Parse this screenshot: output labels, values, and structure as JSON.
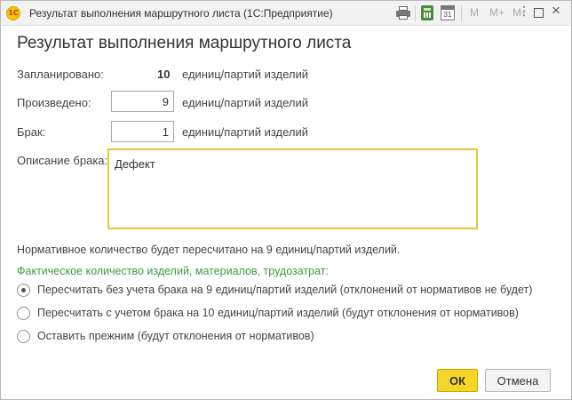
{
  "window": {
    "title": "Результат выполнения маршрутного листа  (1С:Предприятие)",
    "logo_text": "1С",
    "toolbar": {
      "m": "M",
      "m_plus": "M+",
      "m_minus": "M-",
      "calendar_day": "31"
    }
  },
  "form": {
    "heading": "Результат выполнения маршрутного листа",
    "planned": {
      "label": "Запланировано:",
      "value": "10",
      "unit": "единиц/партий изделий"
    },
    "produced": {
      "label": "Произведено:",
      "value": "9",
      "unit": "единиц/партий изделий"
    },
    "defect": {
      "label": "Брак:",
      "value": "1",
      "unit": "единиц/партий изделий"
    },
    "defect_description": {
      "label": "Описание брака:",
      "value": "Дефект"
    },
    "recalc_note": "Нормативное количество будет пересчитано на 9 единиц/партий изделий.",
    "actual_quantity_label": "Фактическое количество изделий, материалов, трудозатрат:",
    "options": [
      {
        "label": "Пересчитать без учета брака на 9 единиц/партий изделий (отклонений от нормативов не будет)",
        "selected": true
      },
      {
        "label": "Пересчитать с учетом брака на 10 единиц/партий изделий (будут отклонения от нормативов)",
        "selected": false
      },
      {
        "label": "Оставить прежним (будут отклонения от нормативов)",
        "selected": false
      }
    ]
  },
  "buttons": {
    "ok": "ОК",
    "cancel": "Отмена"
  },
  "colors": {
    "accent_yellow": "#f7d62a",
    "green_text": "#3e9a3e",
    "focus_border": "#e8c63a"
  }
}
